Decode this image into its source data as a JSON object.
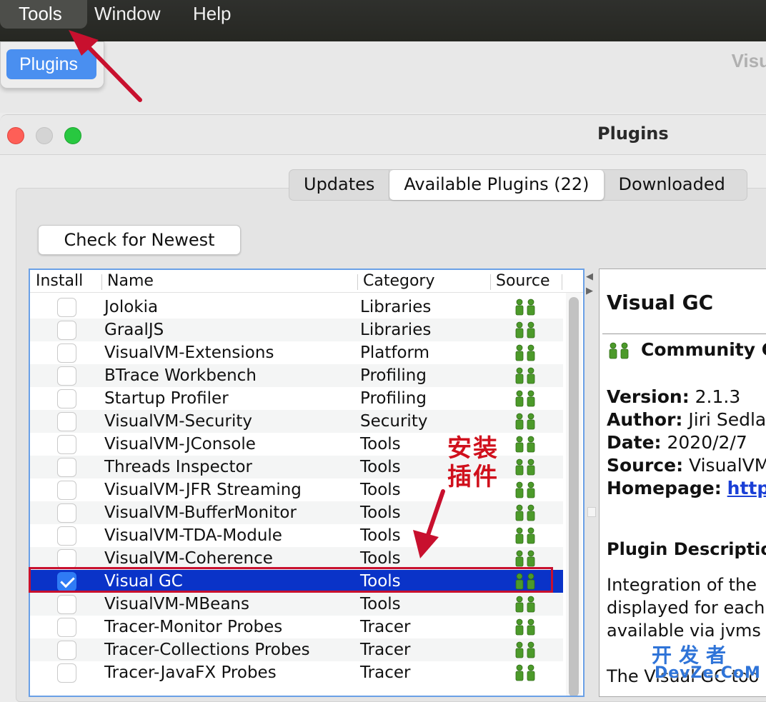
{
  "menubar": {
    "items": [
      "Tools",
      "Window",
      "Help"
    ]
  },
  "dropdown": {
    "item": "Plugins"
  },
  "background_window": {
    "title": "Visu"
  },
  "dialog": {
    "title": "Plugins",
    "tabs": [
      "Updates",
      "Available Plugins (22)",
      "Downloaded"
    ],
    "selected_tab": "Available Plugins (22)",
    "check_button": "Check for Newest"
  },
  "table": {
    "headers": {
      "install": "Install",
      "name": "Name",
      "category": "Category",
      "source": "Source"
    },
    "source_icon": "community-people-icon",
    "rows": [
      {
        "name": "Jolokia",
        "category": "Libraries",
        "checked": false
      },
      {
        "name": "GraalJS",
        "category": "Libraries",
        "checked": false
      },
      {
        "name": "VisualVM-Extensions",
        "category": "Platform",
        "checked": false
      },
      {
        "name": "BTrace Workbench",
        "category": "Profiling",
        "checked": false
      },
      {
        "name": "Startup Profiler",
        "category": "Profiling",
        "checked": false
      },
      {
        "name": "VisualVM-Security",
        "category": "Security",
        "checked": false
      },
      {
        "name": "VisualVM-JConsole",
        "category": "Tools",
        "checked": false
      },
      {
        "name": "Threads Inspector",
        "category": "Tools",
        "checked": false
      },
      {
        "name": "VisualVM-JFR Streaming",
        "category": "Tools",
        "checked": false
      },
      {
        "name": "VisualVM-BufferMonitor",
        "category": "Tools",
        "checked": false
      },
      {
        "name": "VisualVM-TDA-Module",
        "category": "Tools",
        "checked": false
      },
      {
        "name": "VisualVM-Coherence",
        "category": "Tools",
        "checked": false
      },
      {
        "name": "Visual GC",
        "category": "Tools",
        "checked": true,
        "selected": true
      },
      {
        "name": "VisualVM-MBeans",
        "category": "Tools",
        "checked": false
      },
      {
        "name": "Tracer-Monitor Probes",
        "category": "Tracer",
        "checked": false
      },
      {
        "name": "Tracer-Collections Probes",
        "category": "Tracer",
        "checked": false
      },
      {
        "name": "Tracer-JavaFX Probes",
        "category": "Tracer",
        "checked": false
      }
    ]
  },
  "details": {
    "title": "Visual GC",
    "community": "Community C",
    "version_label": "Version:",
    "version": "2.1.3",
    "author_label": "Author:",
    "author": "Jiri Sedlac",
    "date_label": "Date:",
    "date": "2020/2/7",
    "source_label": "Source:",
    "source": "VisualVM",
    "homepage_label": "Homepage:",
    "homepage": "https",
    "description_heading": "Plugin Descriptio",
    "description_lines": [
      "Integration of the",
      "displayed for each",
      "available via jvms",
      "The Visual GC too"
    ]
  },
  "annotation": {
    "line1": "安装",
    "line2": "插件"
  },
  "watermark": {
    "main": "开发者",
    "sub": "DevZe.CoM"
  },
  "colors": {
    "accent": "#4a8ff0",
    "selection": "#0a33c8",
    "annotation_red": "#c8102e",
    "icon_green": "#4c9a2a"
  }
}
